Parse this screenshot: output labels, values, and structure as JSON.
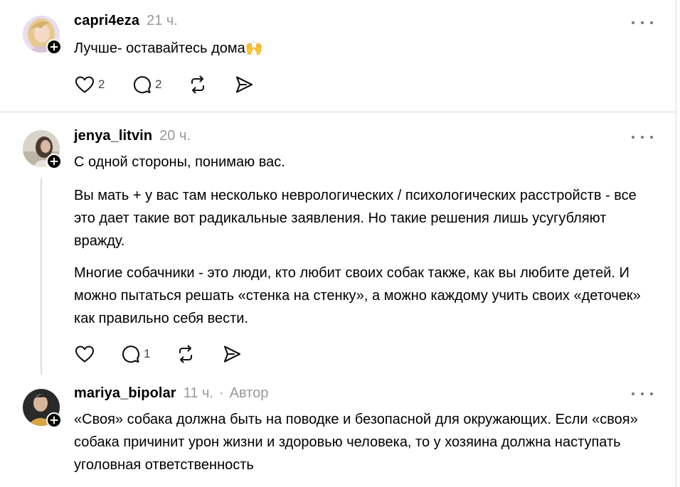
{
  "posts": [
    {
      "username": "capri4eza",
      "time": "21 ч.",
      "text": "Лучше- оставайтесь дома🙌",
      "like_count": "2",
      "reply_count": "2"
    },
    {
      "username": "jenya_litvin",
      "time": "20 ч.",
      "paragraphs": [
        "С одной стороны, понимаю вас.",
        "Вы мать + у вас там несколько неврологических / психологических расстройств - все это дает такие вот радикальные заявления. Но такие решения лишь усугубляют вражду.",
        "Многие собачники - это люди, кто любит своих собак также, как вы любите детей. И можно пытаться решать «стенка на стенку», а можно каждому учить своих «деточек» как правильно себя вести."
      ],
      "reply_count": "1"
    },
    {
      "username": "mariya_bipolar",
      "time": "11 ч.",
      "separator": "·",
      "author_tag": "Автор",
      "text": "«Своя» собака должна быть на поводке и безопасной для окружающих. Если «своя» собака причинит урон жизни и здоровью человека, то у хозяина должна наступать уголовная ответственность"
    }
  ],
  "icons": {
    "like": "heart-icon",
    "reply": "comment-icon",
    "repost": "repost-icon",
    "share": "share-icon",
    "more": "more-icon",
    "follow": "plus-icon"
  },
  "colors": {
    "text": "#000000",
    "muted": "#999999",
    "divider": "#dcdcdc"
  }
}
